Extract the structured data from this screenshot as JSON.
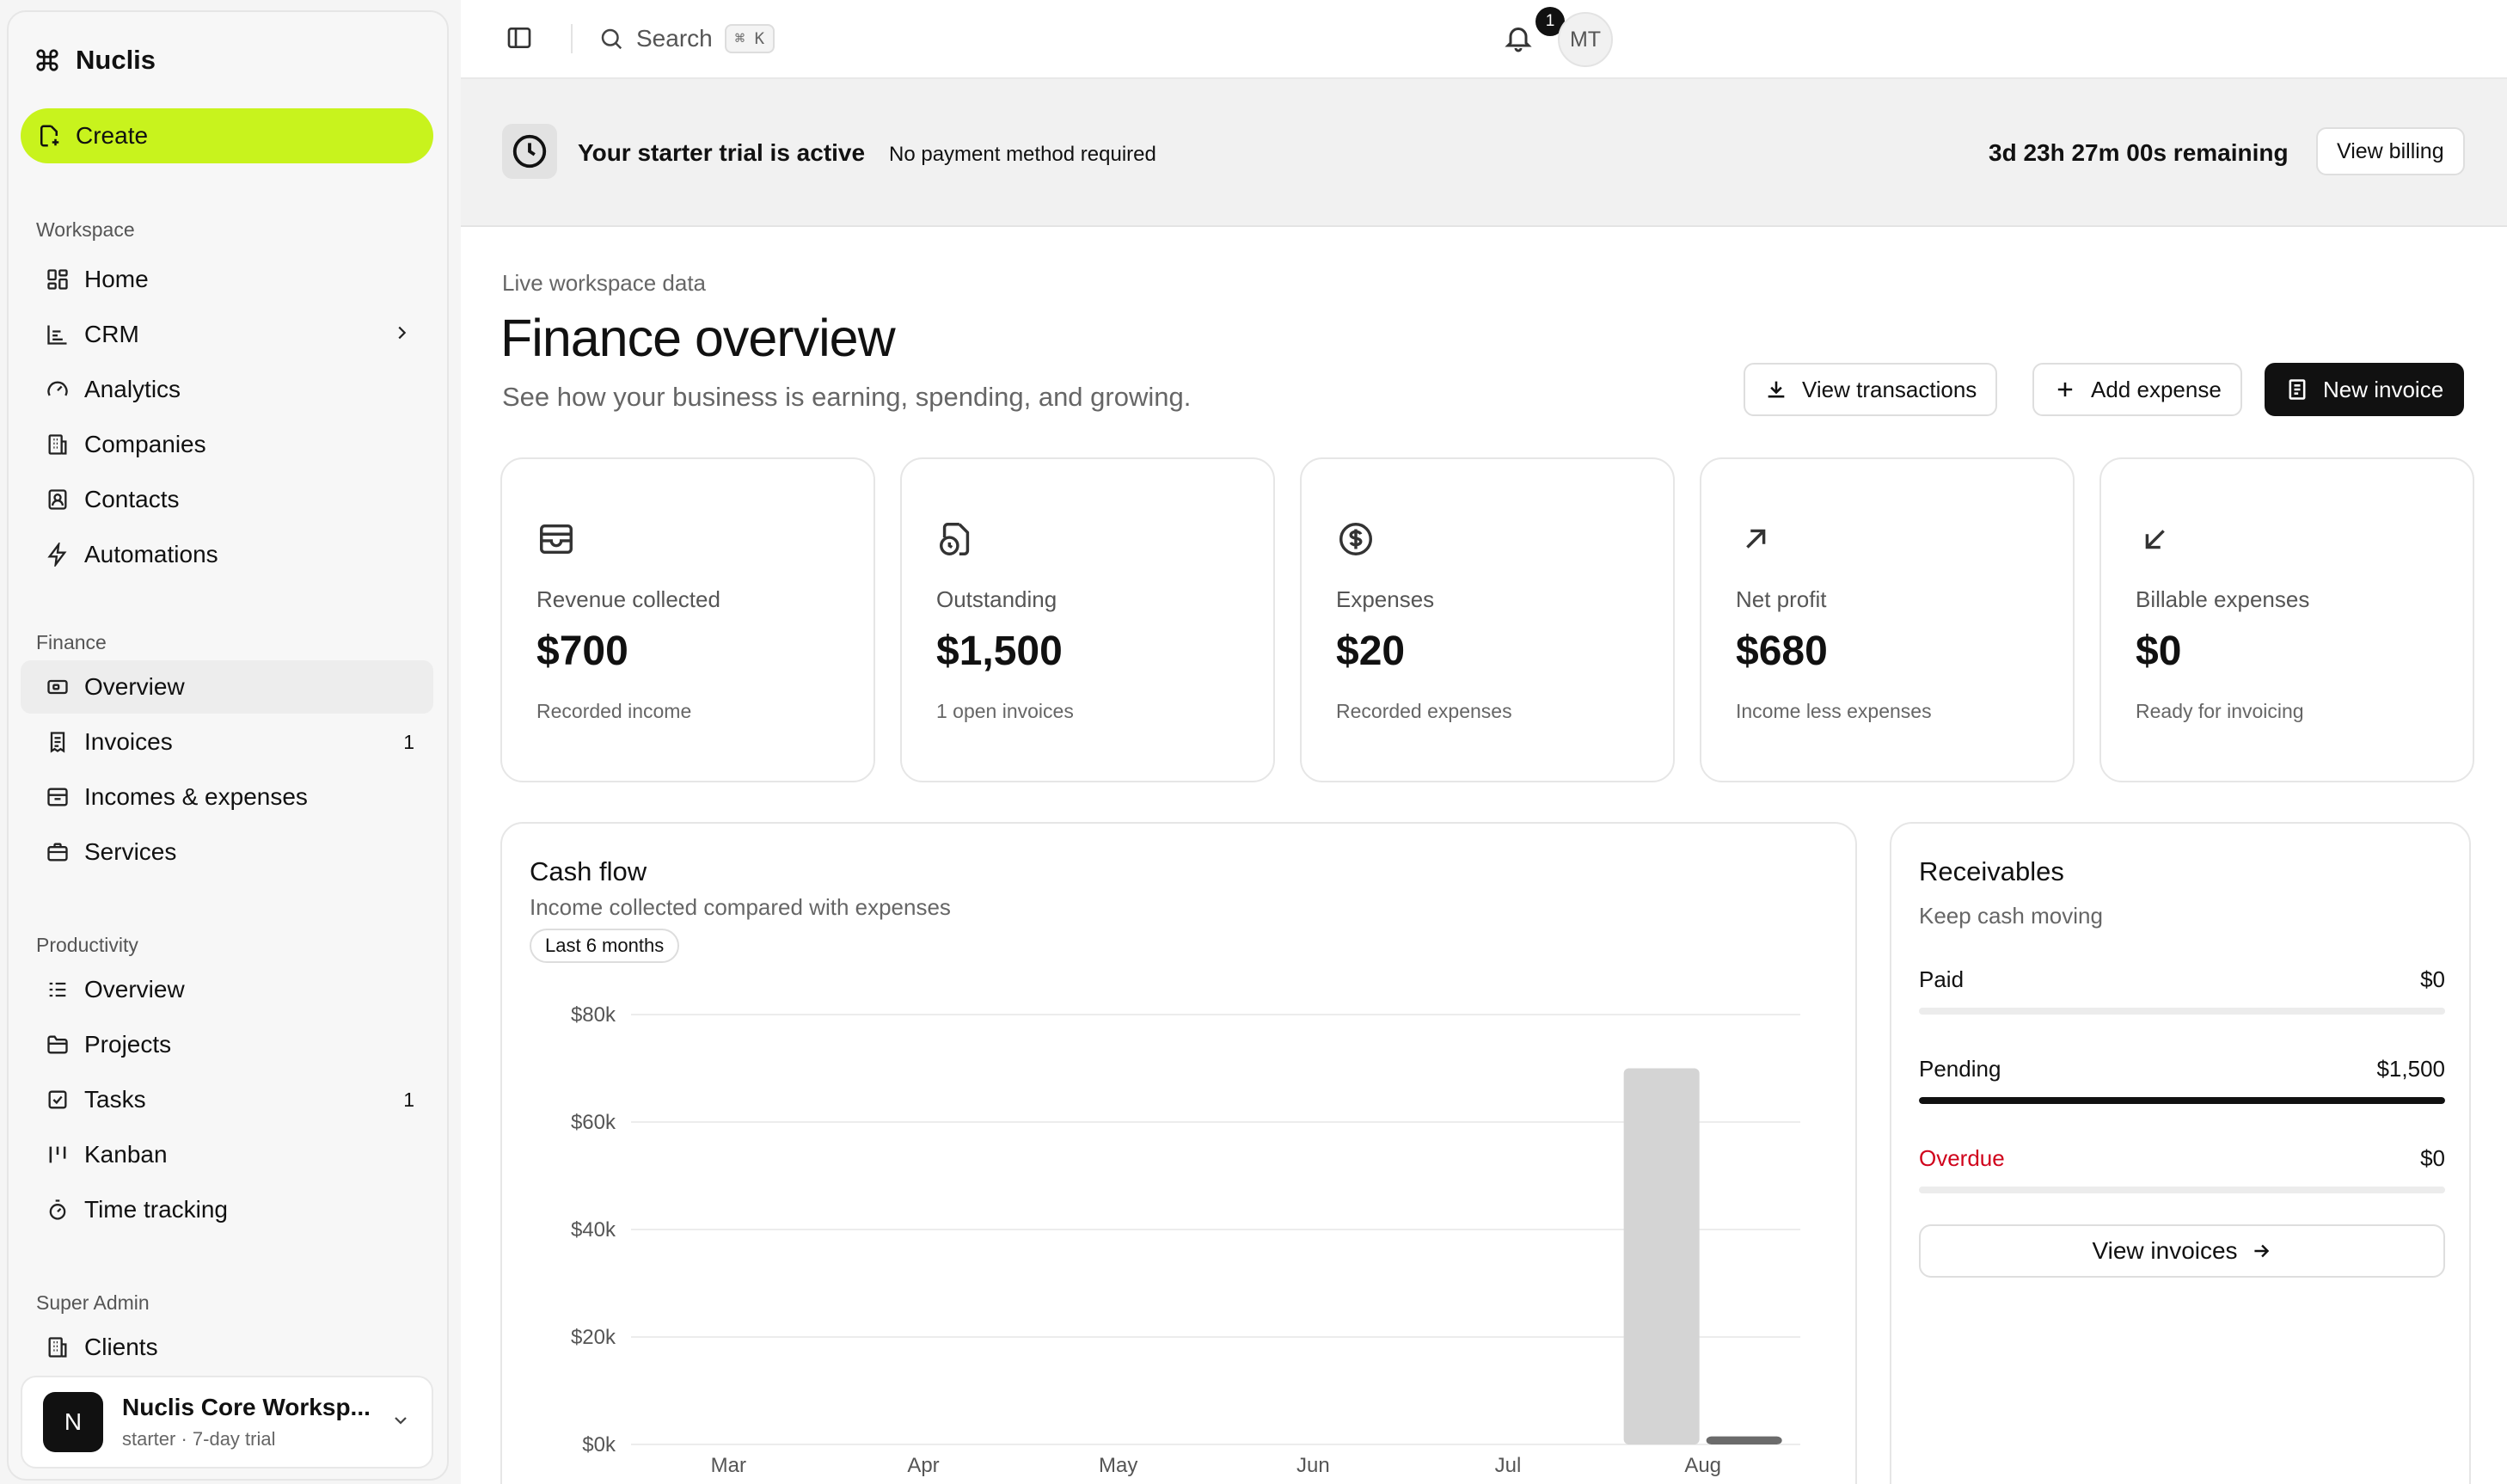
{
  "app": {
    "name": "Nuclis"
  },
  "sidebar": {
    "create_label": "Create",
    "sections": {
      "workspace": "Workspace",
      "finance": "Finance",
      "productivity": "Productivity",
      "super_admin": "Super Admin"
    },
    "workspace_items": [
      {
        "label": "Home",
        "icon": "home-grid-icon"
      },
      {
        "label": "CRM",
        "icon": "crm-chart-icon"
      },
      {
        "label": "Analytics",
        "icon": "gauge-icon"
      },
      {
        "label": "Companies",
        "icon": "building-icon"
      },
      {
        "label": "Contacts",
        "icon": "contact-book-icon"
      },
      {
        "label": "Automations",
        "icon": "bolt-icon"
      }
    ],
    "finance_items": [
      {
        "label": "Overview",
        "icon": "wallet-icon",
        "active": true
      },
      {
        "label": "Invoices",
        "icon": "invoice-icon",
        "count": "1"
      },
      {
        "label": "Incomes & expenses",
        "icon": "archive-icon"
      },
      {
        "label": "Services",
        "icon": "briefcase-icon"
      }
    ],
    "productivity_items": [
      {
        "label": "Overview",
        "icon": "list-icon"
      },
      {
        "label": "Projects",
        "icon": "folder-icon"
      },
      {
        "label": "Tasks",
        "icon": "checkbox-icon",
        "count": "1"
      },
      {
        "label": "Kanban",
        "icon": "kanban-icon"
      },
      {
        "label": "Time tracking",
        "icon": "stopwatch-icon"
      }
    ],
    "admin_items": [
      {
        "label": "Clients",
        "icon": "building-icon"
      }
    ],
    "workspace_switcher": {
      "initial": "N",
      "name": "Nuclis Core Worksp...",
      "plan": "starter · 7-day trial"
    }
  },
  "topbar": {
    "search_placeholder": "Search",
    "search_shortcut": "⌘ K",
    "notification_count": "1",
    "user_initials": "MT"
  },
  "trial": {
    "title": "Your starter trial is active",
    "subtitle": "No payment method required",
    "remaining": "3d 23h 27m 00s remaining",
    "billing_button": "View billing"
  },
  "page": {
    "eyebrow": "Live workspace data",
    "title": "Finance overview",
    "subtitle": "See how your business is earning, spending, and growing.",
    "actions": {
      "view_transactions": "View transactions",
      "add_expense": "Add expense",
      "new_invoice": "New invoice"
    }
  },
  "stats": [
    {
      "label": "Revenue collected",
      "value": "$700",
      "note": "Recorded income",
      "icon": "wallet-icon"
    },
    {
      "label": "Outstanding",
      "value": "$1,500",
      "note": "1 open invoices",
      "icon": "file-clock-icon"
    },
    {
      "label": "Expenses",
      "value": "$20",
      "note": "Recorded expenses",
      "icon": "dollar-circle-icon"
    },
    {
      "label": "Net profit",
      "value": "$680",
      "note": "Income less expenses",
      "icon": "arrow-up-right-icon"
    },
    {
      "label": "Billable expenses",
      "value": "$0",
      "note": "Ready for invoicing",
      "icon": "arrow-down-left-icon"
    }
  ],
  "cash_flow": {
    "title": "Cash flow",
    "subtitle": "Income collected compared with expenses",
    "range_label": "Last 6 months"
  },
  "chart_data": {
    "type": "bar",
    "categories": [
      "Mar",
      "Apr",
      "May",
      "Jun",
      "Jul",
      "Aug"
    ],
    "series": [
      {
        "values": [
          0,
          0,
          0,
          0,
          0,
          70000
        ],
        "color": "#d4d4d4"
      },
      {
        "values": [
          0,
          0,
          0,
          0,
          0,
          1500
        ],
        "color": "#6b6b6b"
      }
    ],
    "y_ticks": [
      "$80k",
      "$60k",
      "$40k",
      "$20k",
      "$0k"
    ],
    "ylim": [
      0,
      80000
    ],
    "grid": true
  },
  "receivables": {
    "title": "Receivables",
    "subtitle": "Keep cash moving",
    "rows": [
      {
        "label": "Paid",
        "value": "$0",
        "fill": 0,
        "color": "#111111"
      },
      {
        "label": "Pending",
        "value": "$1,500",
        "fill": 1,
        "color": "#111111"
      },
      {
        "label": "Overdue",
        "value": "$0",
        "fill": 0,
        "color": "#d0021b"
      }
    ],
    "button": "View invoices"
  },
  "colors": {
    "accent": "#c8f31d",
    "overdue": "#d0021b"
  }
}
